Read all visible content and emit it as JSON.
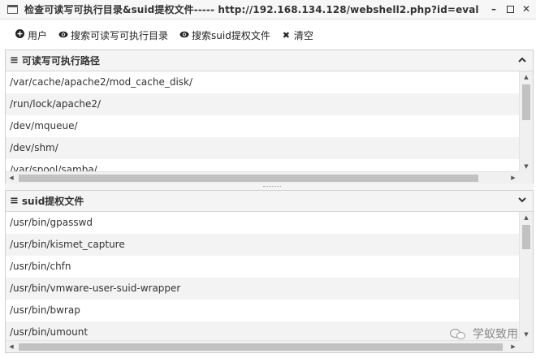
{
  "window": {
    "title": "检查可读写可执行目录&suid提权文件----- http://192.168.134.128/webshell2.php?id=eval",
    "minimize_icon": "minimize-icon",
    "maximize_icon": "maximize-icon",
    "close_icon": "close-icon"
  },
  "toolbar": {
    "items": [
      {
        "label": "用户",
        "icon": "plus-circle-icon"
      },
      {
        "label": "搜索可读写可执行目录",
        "icon": "eye-icon"
      },
      {
        "label": "搜索suid提权文件",
        "icon": "eye-icon"
      },
      {
        "label": "清空",
        "icon": "close-icon"
      }
    ]
  },
  "panel_dirs": {
    "title": "可读写可执行路径",
    "toggle_icon": "chevron-up-icon",
    "rows": [
      "/var/cache/apache2/mod_cache_disk/",
      "/run/lock/apache2/",
      "/dev/mqueue/",
      "/dev/shm/",
      "/var/spool/samba/"
    ]
  },
  "panel_suid": {
    "title": "suid提权文件",
    "toggle_icon": "chevron-down-icon",
    "rows": [
      "/usr/bin/gpasswd",
      "/usr/bin/kismet_capture",
      "/usr/bin/chfn",
      "/usr/bin/vmware-user-suid-wrapper",
      "/usr/bin/bwrap",
      "/usr/bin/umount"
    ]
  },
  "watermark": {
    "text": "学蚁致用",
    "icon": "wechat-icon"
  }
}
